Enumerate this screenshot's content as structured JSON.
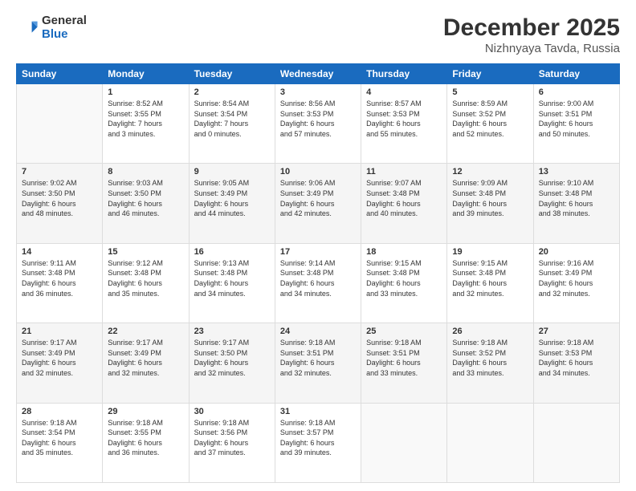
{
  "logo": {
    "general": "General",
    "blue": "Blue"
  },
  "header": {
    "month": "December 2025",
    "location": "Nizhnyaya Tavda, Russia"
  },
  "weekdays": [
    "Sunday",
    "Monday",
    "Tuesday",
    "Wednesday",
    "Thursday",
    "Friday",
    "Saturday"
  ],
  "weeks": [
    [
      {
        "day": "",
        "info": ""
      },
      {
        "day": "1",
        "info": "Sunrise: 8:52 AM\nSunset: 3:55 PM\nDaylight: 7 hours\nand 3 minutes."
      },
      {
        "day": "2",
        "info": "Sunrise: 8:54 AM\nSunset: 3:54 PM\nDaylight: 7 hours\nand 0 minutes."
      },
      {
        "day": "3",
        "info": "Sunrise: 8:56 AM\nSunset: 3:53 PM\nDaylight: 6 hours\nand 57 minutes."
      },
      {
        "day": "4",
        "info": "Sunrise: 8:57 AM\nSunset: 3:53 PM\nDaylight: 6 hours\nand 55 minutes."
      },
      {
        "day": "5",
        "info": "Sunrise: 8:59 AM\nSunset: 3:52 PM\nDaylight: 6 hours\nand 52 minutes."
      },
      {
        "day": "6",
        "info": "Sunrise: 9:00 AM\nSunset: 3:51 PM\nDaylight: 6 hours\nand 50 minutes."
      }
    ],
    [
      {
        "day": "7",
        "info": "Sunrise: 9:02 AM\nSunset: 3:50 PM\nDaylight: 6 hours\nand 48 minutes."
      },
      {
        "day": "8",
        "info": "Sunrise: 9:03 AM\nSunset: 3:50 PM\nDaylight: 6 hours\nand 46 minutes."
      },
      {
        "day": "9",
        "info": "Sunrise: 9:05 AM\nSunset: 3:49 PM\nDaylight: 6 hours\nand 44 minutes."
      },
      {
        "day": "10",
        "info": "Sunrise: 9:06 AM\nSunset: 3:49 PM\nDaylight: 6 hours\nand 42 minutes."
      },
      {
        "day": "11",
        "info": "Sunrise: 9:07 AM\nSunset: 3:48 PM\nDaylight: 6 hours\nand 40 minutes."
      },
      {
        "day": "12",
        "info": "Sunrise: 9:09 AM\nSunset: 3:48 PM\nDaylight: 6 hours\nand 39 minutes."
      },
      {
        "day": "13",
        "info": "Sunrise: 9:10 AM\nSunset: 3:48 PM\nDaylight: 6 hours\nand 38 minutes."
      }
    ],
    [
      {
        "day": "14",
        "info": "Sunrise: 9:11 AM\nSunset: 3:48 PM\nDaylight: 6 hours\nand 36 minutes."
      },
      {
        "day": "15",
        "info": "Sunrise: 9:12 AM\nSunset: 3:48 PM\nDaylight: 6 hours\nand 35 minutes."
      },
      {
        "day": "16",
        "info": "Sunrise: 9:13 AM\nSunset: 3:48 PM\nDaylight: 6 hours\nand 34 minutes."
      },
      {
        "day": "17",
        "info": "Sunrise: 9:14 AM\nSunset: 3:48 PM\nDaylight: 6 hours\nand 34 minutes."
      },
      {
        "day": "18",
        "info": "Sunrise: 9:15 AM\nSunset: 3:48 PM\nDaylight: 6 hours\nand 33 minutes."
      },
      {
        "day": "19",
        "info": "Sunrise: 9:15 AM\nSunset: 3:48 PM\nDaylight: 6 hours\nand 32 minutes."
      },
      {
        "day": "20",
        "info": "Sunrise: 9:16 AM\nSunset: 3:49 PM\nDaylight: 6 hours\nand 32 minutes."
      }
    ],
    [
      {
        "day": "21",
        "info": "Sunrise: 9:17 AM\nSunset: 3:49 PM\nDaylight: 6 hours\nand 32 minutes."
      },
      {
        "day": "22",
        "info": "Sunrise: 9:17 AM\nSunset: 3:49 PM\nDaylight: 6 hours\nand 32 minutes."
      },
      {
        "day": "23",
        "info": "Sunrise: 9:17 AM\nSunset: 3:50 PM\nDaylight: 6 hours\nand 32 minutes."
      },
      {
        "day": "24",
        "info": "Sunrise: 9:18 AM\nSunset: 3:51 PM\nDaylight: 6 hours\nand 32 minutes."
      },
      {
        "day": "25",
        "info": "Sunrise: 9:18 AM\nSunset: 3:51 PM\nDaylight: 6 hours\nand 33 minutes."
      },
      {
        "day": "26",
        "info": "Sunrise: 9:18 AM\nSunset: 3:52 PM\nDaylight: 6 hours\nand 33 minutes."
      },
      {
        "day": "27",
        "info": "Sunrise: 9:18 AM\nSunset: 3:53 PM\nDaylight: 6 hours\nand 34 minutes."
      }
    ],
    [
      {
        "day": "28",
        "info": "Sunrise: 9:18 AM\nSunset: 3:54 PM\nDaylight: 6 hours\nand 35 minutes."
      },
      {
        "day": "29",
        "info": "Sunrise: 9:18 AM\nSunset: 3:55 PM\nDaylight: 6 hours\nand 36 minutes."
      },
      {
        "day": "30",
        "info": "Sunrise: 9:18 AM\nSunset: 3:56 PM\nDaylight: 6 hours\nand 37 minutes."
      },
      {
        "day": "31",
        "info": "Sunrise: 9:18 AM\nSunset: 3:57 PM\nDaylight: 6 hours\nand 39 minutes."
      },
      {
        "day": "",
        "info": ""
      },
      {
        "day": "",
        "info": ""
      },
      {
        "day": "",
        "info": ""
      }
    ]
  ]
}
